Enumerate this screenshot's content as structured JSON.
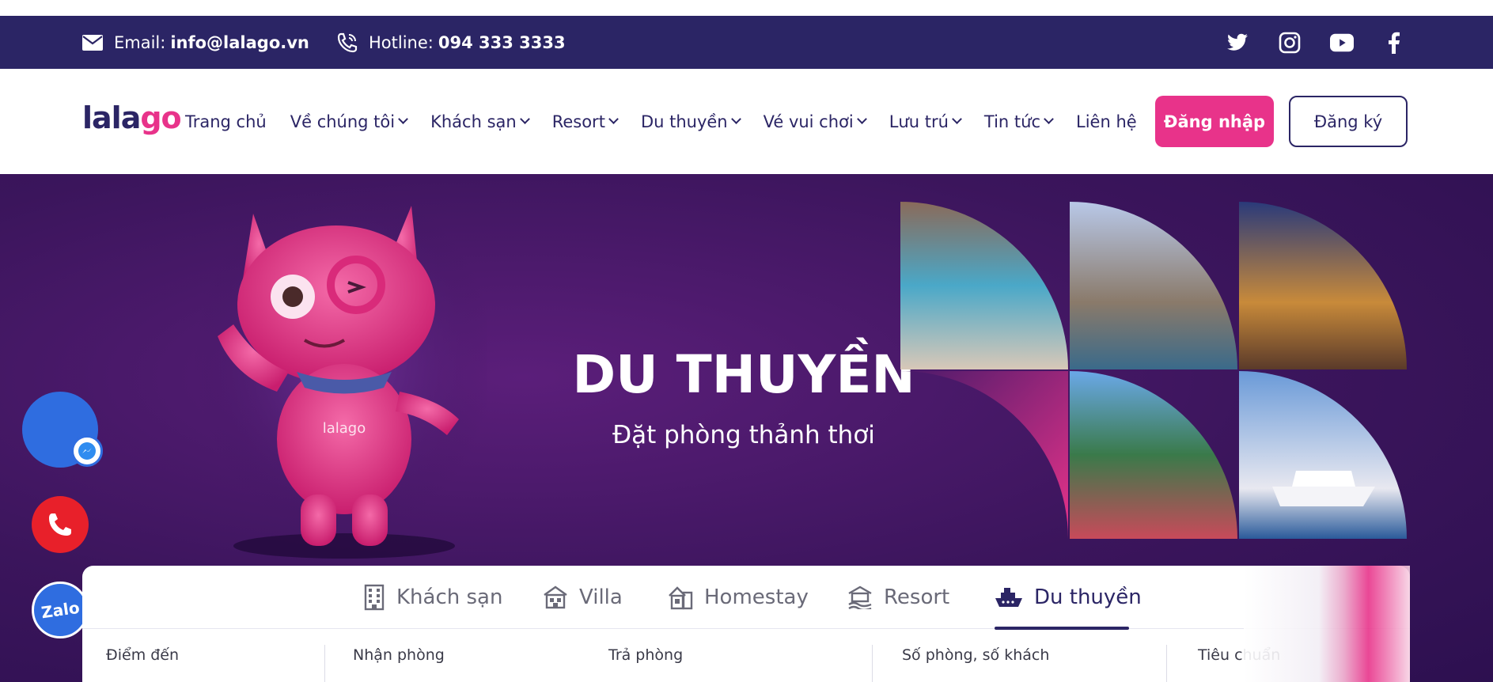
{
  "topbar": {
    "email_label": "Email:",
    "email_value": "info@lalago.vn",
    "hotline_label": "Hotline:",
    "hotline_value": "094 333 3333",
    "social_icons": [
      "twitter-icon",
      "instagram-icon",
      "youtube-icon",
      "facebook-icon"
    ]
  },
  "nav": {
    "logo_text_a": "lala",
    "logo_text_b": "go",
    "items": [
      {
        "label": "Trang chủ",
        "has_dropdown": false
      },
      {
        "label": "Về chúng tôi",
        "has_dropdown": true
      },
      {
        "label": "Khách sạn",
        "has_dropdown": true
      },
      {
        "label": "Resort",
        "has_dropdown": true
      },
      {
        "label": "Du thuyền",
        "has_dropdown": true
      },
      {
        "label": "Vé vui chơi",
        "has_dropdown": true
      },
      {
        "label": "Lưu trú",
        "has_dropdown": true
      },
      {
        "label": "Tin tức",
        "has_dropdown": true
      },
      {
        "label": "Liên hệ",
        "has_dropdown": false
      }
    ],
    "login_label": "Đăng nhập",
    "register_label": "Đăng ký"
  },
  "hero": {
    "title": "DU THUYỀN",
    "subtitle": "Đặt phòng thảnh thơi",
    "mascot_badge": "lalago"
  },
  "booking": {
    "tabs": [
      {
        "label": "Khách sạn",
        "icon": "building-icon",
        "active": false
      },
      {
        "label": "Villa",
        "icon": "villa-icon",
        "active": false
      },
      {
        "label": "Homestay",
        "icon": "homestay-icon",
        "active": false
      },
      {
        "label": "Resort",
        "icon": "resort-icon",
        "active": false
      },
      {
        "label": "Du thuyền",
        "icon": "cruise-ship-icon",
        "active": true
      }
    ],
    "fields": [
      "Điểm đến",
      "Nhận phòng",
      "Trả phòng",
      "Số phòng, số khách",
      "Tiêu chuẩn"
    ]
  },
  "floating": {
    "zalo_label": "Zalo"
  },
  "colors": {
    "brand_navy": "#2b2565",
    "brand_pink": "#e8338a",
    "hero_purple": "#3b155c"
  }
}
